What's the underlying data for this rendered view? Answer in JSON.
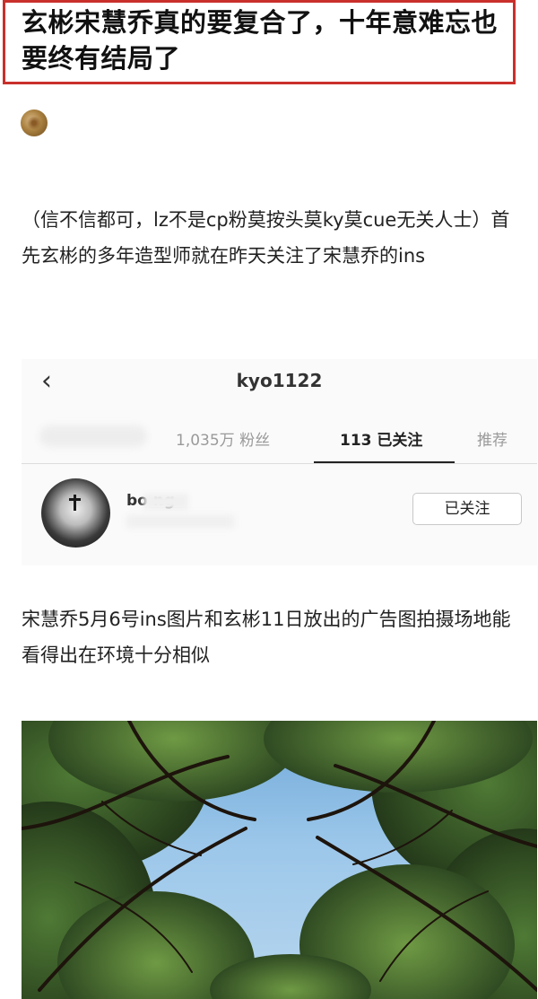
{
  "article": {
    "title": "玄彬宋慧乔真的要复合了，十年意难忘也要终有结局了",
    "paragraph_1": "（信不信都可，lz不是cp粉莫按头莫ky莫cue无关人士）首先玄彬的多年造型师就在昨天关注了宋慧乔的ins",
    "paragraph_2": "宋慧乔5月6号ins图片和玄彬11日放出的广告图拍摄场地能看得出在环境十分相似"
  },
  "instagram": {
    "back_icon": "chevron-left-icon",
    "username": "kyo1122",
    "tabs": {
      "followers": "1,035万 粉丝",
      "following": "113 已关注",
      "suggested": "推荐"
    },
    "followed_user": {
      "handle": "bo      ng",
      "follow_button": "已关注"
    }
  },
  "colors": {
    "title_border": "#c9302c",
    "sky": "#9cc7ea",
    "foliage": "#2f4a22"
  }
}
